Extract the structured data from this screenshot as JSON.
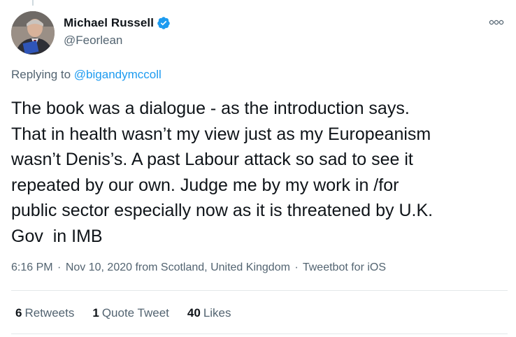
{
  "tweet": {
    "author": {
      "display_name": "Michael Russell",
      "handle": "@Feorlean",
      "verified": true,
      "avatar_icon": "profile-photo"
    },
    "replying_to_prefix": "Replying to",
    "replying_to_handle": "@bigandymccoll",
    "text": "The book was a dialogue - as the introduction says.\nThat in health wasn’t my view just as my Europeanism\nwasn’t Denis’s. A past Labour attack so sad to see it\nrepeated by our own. Judge me by my work in /for\npublic sector especially now as it is threatened by U.K.\nGov  in IMB",
    "time": "6:16 PM",
    "date": "Nov 10, 2020",
    "location": "from Scotland, United Kingdom",
    "source": "Tweetbot for iOS",
    "separator": "·",
    "stats": {
      "retweets_count": "6",
      "retweets_label": "Retweets",
      "quote_tweets_count": "1",
      "quote_tweets_label": "Quote Tweet",
      "likes_count": "40",
      "likes_label": "Likes"
    }
  },
  "colors": {
    "text_primary": "#0f1419",
    "text_secondary": "#536471",
    "link": "#1d9bf0",
    "verified_badge": "#1d9bf0",
    "divider": "#e3e8ea"
  }
}
